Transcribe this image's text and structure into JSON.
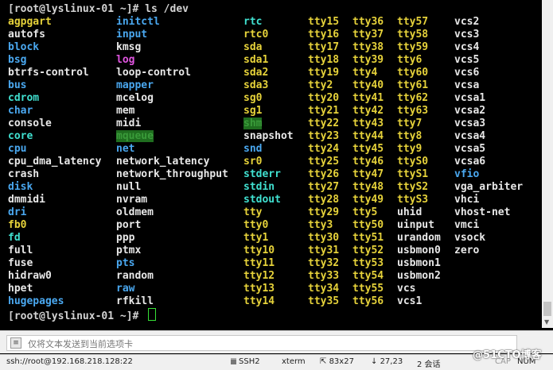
{
  "terminal": {
    "prompt1": "[root@lyslinux-01 ~]# ls /dev",
    "prompt2": "[root@lyslinux-01 ~]# ",
    "columns": [
      [
        {
          "t": "agpgart",
          "c": "y"
        },
        {
          "t": "autofs",
          "c": "w"
        },
        {
          "t": "block",
          "c": "b"
        },
        {
          "t": "bsg",
          "c": "b"
        },
        {
          "t": "btrfs-control",
          "c": "w"
        },
        {
          "t": "bus",
          "c": "b"
        },
        {
          "t": "cdrom",
          "c": "c"
        },
        {
          "t": "char",
          "c": "b"
        },
        {
          "t": "console",
          "c": "w"
        },
        {
          "t": "core",
          "c": "c"
        },
        {
          "t": "cpu",
          "c": "b"
        },
        {
          "t": "cpu_dma_latency",
          "c": "w"
        },
        {
          "t": "crash",
          "c": "w"
        },
        {
          "t": "disk",
          "c": "b"
        },
        {
          "t": "dmmidi",
          "c": "w"
        },
        {
          "t": "dri",
          "c": "b"
        },
        {
          "t": "fb0",
          "c": "y"
        },
        {
          "t": "fd",
          "c": "c"
        },
        {
          "t": "full",
          "c": "w"
        },
        {
          "t": "fuse",
          "c": "w"
        },
        {
          "t": "hidraw0",
          "c": "w"
        },
        {
          "t": "hpet",
          "c": "w"
        },
        {
          "t": "hugepages",
          "c": "b"
        }
      ],
      [
        {
          "t": "initctl",
          "c": "b"
        },
        {
          "t": "input",
          "c": "b"
        },
        {
          "t": "kmsg",
          "c": "w"
        },
        {
          "t": "log",
          "c": "m"
        },
        {
          "t": "loop-control",
          "c": "w"
        },
        {
          "t": "mapper",
          "c": "b"
        },
        {
          "t": "mcelog",
          "c": "w"
        },
        {
          "t": "mem",
          "c": "w"
        },
        {
          "t": "midi",
          "c": "w"
        },
        {
          "t": "mqueue",
          "c": "hl"
        },
        {
          "t": "net",
          "c": "b"
        },
        {
          "t": "network_latency",
          "c": "w"
        },
        {
          "t": "network_throughput",
          "c": "w"
        },
        {
          "t": "null",
          "c": "w"
        },
        {
          "t": "nvram",
          "c": "w"
        },
        {
          "t": "oldmem",
          "c": "w"
        },
        {
          "t": "port",
          "c": "w"
        },
        {
          "t": "ppp",
          "c": "w"
        },
        {
          "t": "ptmx",
          "c": "w"
        },
        {
          "t": "pts",
          "c": "b"
        },
        {
          "t": "random",
          "c": "w"
        },
        {
          "t": "raw",
          "c": "b"
        },
        {
          "t": "rfkill",
          "c": "w"
        }
      ],
      [
        {
          "t": "rtc",
          "c": "c"
        },
        {
          "t": "rtc0",
          "c": "y"
        },
        {
          "t": "sda",
          "c": "y"
        },
        {
          "t": "sda1",
          "c": "y"
        },
        {
          "t": "sda2",
          "c": "y"
        },
        {
          "t": "sda3",
          "c": "y"
        },
        {
          "t": "sg0",
          "c": "y"
        },
        {
          "t": "sg1",
          "c": "y"
        },
        {
          "t": "shm",
          "c": "hl"
        },
        {
          "t": "snapshot",
          "c": "w"
        },
        {
          "t": "snd",
          "c": "b"
        },
        {
          "t": "sr0",
          "c": "y"
        },
        {
          "t": "stderr",
          "c": "c"
        },
        {
          "t": "stdin",
          "c": "c"
        },
        {
          "t": "stdout",
          "c": "c"
        },
        {
          "t": "tty",
          "c": "y"
        },
        {
          "t": "tty0",
          "c": "y"
        },
        {
          "t": "tty1",
          "c": "y"
        },
        {
          "t": "tty10",
          "c": "y"
        },
        {
          "t": "tty11",
          "c": "y"
        },
        {
          "t": "tty12",
          "c": "y"
        },
        {
          "t": "tty13",
          "c": "y"
        },
        {
          "t": "tty14",
          "c": "y"
        }
      ],
      [
        {
          "t": "tty15",
          "c": "y"
        },
        {
          "t": "tty16",
          "c": "y"
        },
        {
          "t": "tty17",
          "c": "y"
        },
        {
          "t": "tty18",
          "c": "y"
        },
        {
          "t": "tty19",
          "c": "y"
        },
        {
          "t": "tty2",
          "c": "y"
        },
        {
          "t": "tty20",
          "c": "y"
        },
        {
          "t": "tty21",
          "c": "y"
        },
        {
          "t": "tty22",
          "c": "y"
        },
        {
          "t": "tty23",
          "c": "y"
        },
        {
          "t": "tty24",
          "c": "y"
        },
        {
          "t": "tty25",
          "c": "y"
        },
        {
          "t": "tty26",
          "c": "y"
        },
        {
          "t": "tty27",
          "c": "y"
        },
        {
          "t": "tty28",
          "c": "y"
        },
        {
          "t": "tty29",
          "c": "y"
        },
        {
          "t": "tty3",
          "c": "y"
        },
        {
          "t": "tty30",
          "c": "y"
        },
        {
          "t": "tty31",
          "c": "y"
        },
        {
          "t": "tty32",
          "c": "y"
        },
        {
          "t": "tty33",
          "c": "y"
        },
        {
          "t": "tty34",
          "c": "y"
        },
        {
          "t": "tty35",
          "c": "y"
        }
      ],
      [
        {
          "t": "tty36",
          "c": "y"
        },
        {
          "t": "tty37",
          "c": "y"
        },
        {
          "t": "tty38",
          "c": "y"
        },
        {
          "t": "tty39",
          "c": "y"
        },
        {
          "t": "tty4",
          "c": "y"
        },
        {
          "t": "tty40",
          "c": "y"
        },
        {
          "t": "tty41",
          "c": "y"
        },
        {
          "t": "tty42",
          "c": "y"
        },
        {
          "t": "tty43",
          "c": "y"
        },
        {
          "t": "tty44",
          "c": "y"
        },
        {
          "t": "tty45",
          "c": "y"
        },
        {
          "t": "tty46",
          "c": "y"
        },
        {
          "t": "tty47",
          "c": "y"
        },
        {
          "t": "tty48",
          "c": "y"
        },
        {
          "t": "tty49",
          "c": "y"
        },
        {
          "t": "tty5",
          "c": "y"
        },
        {
          "t": "tty50",
          "c": "y"
        },
        {
          "t": "tty51",
          "c": "y"
        },
        {
          "t": "tty52",
          "c": "y"
        },
        {
          "t": "tty53",
          "c": "y"
        },
        {
          "t": "tty54",
          "c": "y"
        },
        {
          "t": "tty55",
          "c": "y"
        },
        {
          "t": "tty56",
          "c": "y"
        }
      ],
      [
        {
          "t": "tty57",
          "c": "y"
        },
        {
          "t": "tty58",
          "c": "y"
        },
        {
          "t": "tty59",
          "c": "y"
        },
        {
          "t": "tty6",
          "c": "y"
        },
        {
          "t": "tty60",
          "c": "y"
        },
        {
          "t": "tty61",
          "c": "y"
        },
        {
          "t": "tty62",
          "c": "y"
        },
        {
          "t": "tty63",
          "c": "y"
        },
        {
          "t": "tty7",
          "c": "y"
        },
        {
          "t": "tty8",
          "c": "y"
        },
        {
          "t": "tty9",
          "c": "y"
        },
        {
          "t": "ttyS0",
          "c": "y"
        },
        {
          "t": "ttyS1",
          "c": "y"
        },
        {
          "t": "ttyS2",
          "c": "y"
        },
        {
          "t": "ttyS3",
          "c": "y"
        },
        {
          "t": "uhid",
          "c": "w"
        },
        {
          "t": "uinput",
          "c": "w"
        },
        {
          "t": "urandom",
          "c": "w"
        },
        {
          "t": "usbmon0",
          "c": "w"
        },
        {
          "t": "usbmon1",
          "c": "w"
        },
        {
          "t": "usbmon2",
          "c": "w"
        },
        {
          "t": "vcs",
          "c": "w"
        },
        {
          "t": "vcs1",
          "c": "w"
        }
      ],
      [
        {
          "t": "vcs2",
          "c": "w"
        },
        {
          "t": "vcs3",
          "c": "w"
        },
        {
          "t": "vcs4",
          "c": "w"
        },
        {
          "t": "vcs5",
          "c": "w"
        },
        {
          "t": "vcs6",
          "c": "w"
        },
        {
          "t": "vcsa",
          "c": "w"
        },
        {
          "t": "vcsa1",
          "c": "w"
        },
        {
          "t": "vcsa2",
          "c": "w"
        },
        {
          "t": "vcsa3",
          "c": "w"
        },
        {
          "t": "vcsa4",
          "c": "w"
        },
        {
          "t": "vcsa5",
          "c": "w"
        },
        {
          "t": "vcsa6",
          "c": "w"
        },
        {
          "t": "vfio",
          "c": "b"
        },
        {
          "t": "vga_arbiter",
          "c": "w"
        },
        {
          "t": "vhci",
          "c": "w"
        },
        {
          "t": "vhost-net",
          "c": "w"
        },
        {
          "t": "vmci",
          "c": "w"
        },
        {
          "t": "vsock",
          "c": "w"
        },
        {
          "t": "zero",
          "c": "w"
        }
      ]
    ]
  },
  "sendbar": {
    "placeholder": "仅将文本发送到当前选项卡"
  },
  "statusbar": {
    "connection": "ssh://root@192.168.218.128:22",
    "protocol": "SSH2",
    "terminal_type": "xterm",
    "size": "83x27",
    "cursor_pos": "27,23",
    "sessions": "2 会话",
    "caps": "CAP",
    "num": "NUM"
  },
  "watermark": "@51CTO博客"
}
